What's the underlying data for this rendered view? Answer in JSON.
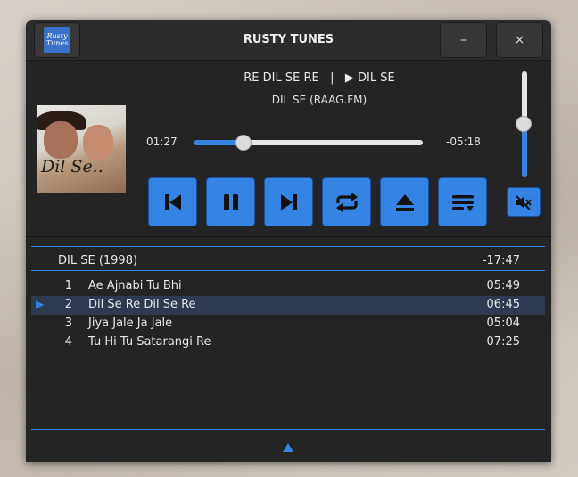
{
  "app": {
    "title": "RUSTY TUNES",
    "logo_line1": "Rusty",
    "logo_line2": "Tunes",
    "minimize_label": "–",
    "close_label": "×"
  },
  "colors": {
    "accent": "#3584e4",
    "window_bg": "#242424",
    "titlebar_bg": "#2c2c2c",
    "selected_row_bg": "#2d3a52",
    "text": "#e8e8e8"
  },
  "now_playing": {
    "track": "RE DIL SE RE",
    "separator": "|",
    "state_glyph": "▶",
    "album": "DIL SE",
    "source": "DIL SE (RAAG.FM)",
    "cover_text": "Dil Se.."
  },
  "progress": {
    "elapsed": "01:27",
    "remaining": "-05:18",
    "fraction": 0.215
  },
  "volume": {
    "level": 0.5
  },
  "controls": [
    {
      "name": "previous-button",
      "icon": "skip-previous-icon"
    },
    {
      "name": "pause-button",
      "icon": "pause-icon"
    },
    {
      "name": "next-button",
      "icon": "skip-next-icon"
    },
    {
      "name": "repeat-button",
      "icon": "repeat-icon"
    },
    {
      "name": "eject-button",
      "icon": "eject-icon"
    },
    {
      "name": "playlist-button",
      "icon": "playlist-icon"
    }
  ],
  "mute_icon": "speaker-muted-icon",
  "album": {
    "name": "DIL SE (1998)",
    "duration": "-17:47"
  },
  "tracks": [
    {
      "number": "1",
      "title": "Ae Ajnabi Tu Bhi",
      "duration": "05:49",
      "playing": false
    },
    {
      "number": "2",
      "title": "Dil Se Re Dil Se Re",
      "duration": "06:45",
      "playing": true
    },
    {
      "number": "3",
      "title": "Jiya Jale Ja Jale",
      "duration": "05:04",
      "playing": false
    },
    {
      "number": "4",
      "title": "Tu Hi Tu Satarangi Re",
      "duration": "07:25",
      "playing": false
    }
  ],
  "playing_marker": "▶",
  "footer_icon": "triangle-up-icon"
}
